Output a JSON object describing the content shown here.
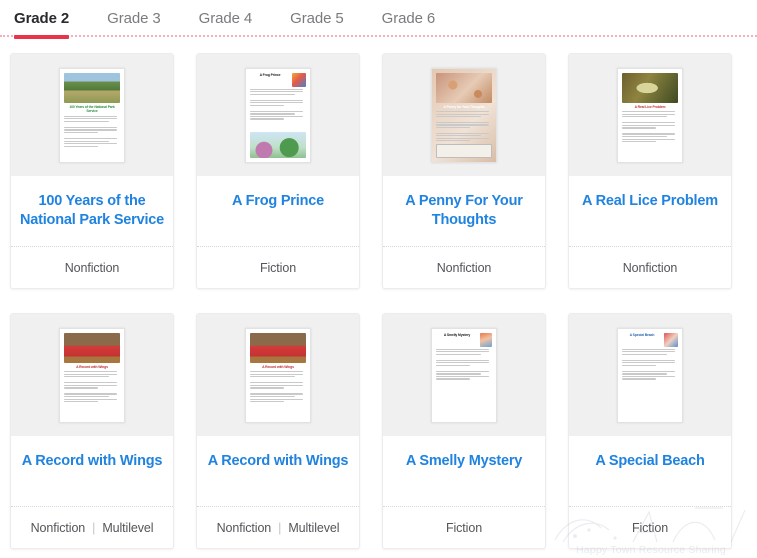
{
  "tabs": [
    {
      "label": "Grade 2",
      "active": true
    },
    {
      "label": "Grade 3",
      "active": false
    },
    {
      "label": "Grade 4",
      "active": false
    },
    {
      "label": "Grade 5",
      "active": false
    },
    {
      "label": "Grade 6",
      "active": false
    }
  ],
  "colors": {
    "active_tab_underline": "#e8334a",
    "inactive_rule": "#f6aebe",
    "card_title": "#2083e0",
    "thumb_background": "#f0f0f0",
    "meta_text": "#55555a"
  },
  "cards": [
    {
      "title": "100 Years of the National Park Service",
      "categories": [
        "Nonfiction"
      ],
      "thumbnail": {
        "name": "worksheet-thumbnail-national-park",
        "heading": "100 Years of the National Park Service",
        "heading_color": "green",
        "photo": "nature"
      }
    },
    {
      "title": "A Frog Prince",
      "categories": [
        "Fiction"
      ],
      "thumbnail": {
        "name": "worksheet-thumbnail-frog-prince",
        "heading": "A Frog Prince",
        "heading_color": "dark",
        "photo": "frogbadge"
      }
    },
    {
      "title": "A Penny For Your Thoughts",
      "categories": [
        "Nonfiction"
      ],
      "thumbnail": {
        "name": "worksheet-thumbnail-penny-thoughts",
        "heading": "A Penny for Your Thoughts",
        "heading_color": "white",
        "photo": "penny"
      }
    },
    {
      "title": "A Real Lice Problem",
      "categories": [
        "Nonfiction"
      ],
      "thumbnail": {
        "name": "worksheet-thumbnail-real-lice-problem",
        "heading": "A Real Lice Problem",
        "heading_color": "red",
        "photo": "lice"
      }
    },
    {
      "title": "A Record with Wings",
      "categories": [
        "Nonfiction",
        "Multilevel"
      ],
      "thumbnail": {
        "name": "worksheet-thumbnail-record-with-wings",
        "heading": "A Record with Wings",
        "heading_color": "red",
        "photo": "gym"
      }
    },
    {
      "title": "A Record with Wings",
      "categories": [
        "Nonfiction",
        "Multilevel"
      ],
      "thumbnail": {
        "name": "worksheet-thumbnail-record-with-wings-2",
        "heading": "A Record with Wings",
        "heading_color": "red",
        "photo": "gym"
      }
    },
    {
      "title": "A Smelly Mystery",
      "categories": [
        "Fiction"
      ],
      "thumbnail": {
        "name": "worksheet-thumbnail-smelly-mystery",
        "heading": "A Smelly Mystery",
        "heading_color": "dark",
        "photo": "mysterybadge"
      }
    },
    {
      "title": "A Special Beach",
      "categories": [
        "Fiction"
      ],
      "thumbnail": {
        "name": "worksheet-thumbnail-special-beach",
        "heading": "A Special Beach",
        "heading_color": "blue",
        "photo": "beachbadge"
      }
    }
  ],
  "watermark": {
    "text": "Happy Town Resource Sharing"
  },
  "meta_separator": "|"
}
